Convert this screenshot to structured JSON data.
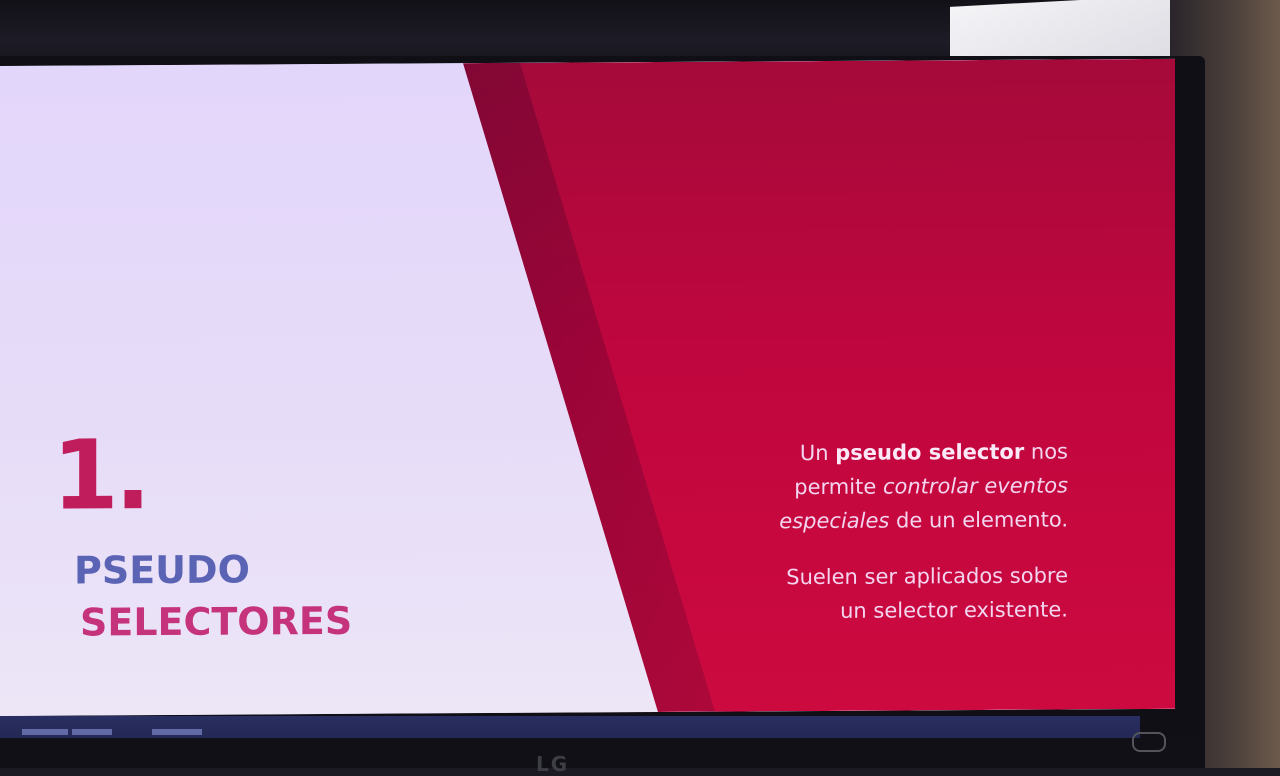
{
  "slide": {
    "number": "1.",
    "title_line1": "PSEUDO",
    "title_line2": "SELECTORES",
    "para1": {
      "w1": "Un",
      "w2": "pseudo selector",
      "w3": "nos",
      "w4": "permite",
      "w5": "controlar eventos",
      "w6": "especiales",
      "w7": "de un elemento."
    },
    "para2": {
      "line1": "Suelen ser aplicados sobre",
      "line2": "un selector existente."
    }
  },
  "monitor": {
    "brand": "LG"
  },
  "colors": {
    "accent_red": "#c0063e",
    "light_bg": "#e3d6fb",
    "number_color": "#c01d5d",
    "title_blue": "#5b63b5",
    "title_pink": "#c5337c"
  }
}
